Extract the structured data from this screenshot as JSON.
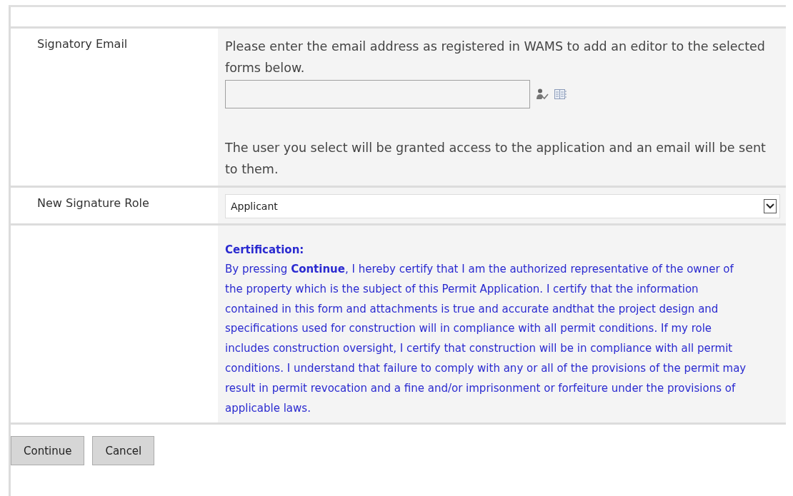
{
  "email_row": {
    "label": "Signatory Email",
    "instructions": "Please enter the email address as registered in WAMS to add an editor to the selected forms below.",
    "note": "The user you select will be granted access to the application and an email will be sent to them."
  },
  "role_row": {
    "label": "New Signature Role",
    "select": {
      "value": "Applicant"
    }
  },
  "certification": {
    "heading": "Certification:",
    "text": "By pressing **Continue**, I hereby certify that I am the authorized representative of the owner of the property which is the subject of this Permit Application. I certify that the information contained in this form and attachments is true and accurate andthat the project design and specifications used for construction will in compliance with all permit conditions. If my role includes construction oversight, I certify that construction will be in compliance with all permit conditions. I understand that failure to comply with any or all of the provisions of the permit may result in permit revocation and a fine and/or imprisonment or forfeiture under the provisions of applicable laws."
  },
  "buttons": [
    {
      "label": "Continue"
    },
    {
      "label": "Cancel"
    }
  ]
}
